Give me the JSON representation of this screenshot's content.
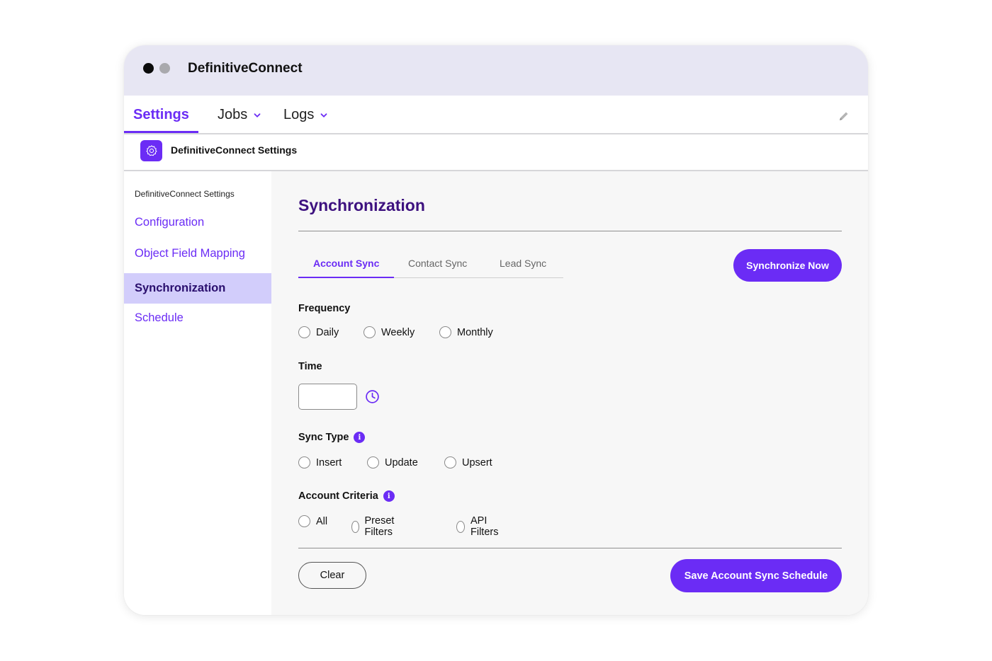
{
  "app": {
    "title": "DefinitiveConnect"
  },
  "nav": {
    "items": [
      {
        "label": "Settings"
      },
      {
        "label": "Jobs"
      },
      {
        "label": "Logs"
      }
    ]
  },
  "page_header": {
    "title": "DefinitiveConnect Settings"
  },
  "sidebar": {
    "heading": "DefinitiveConnect Settings",
    "items": [
      {
        "label": "Configuration"
      },
      {
        "label": "Object Field Mapping"
      },
      {
        "label": "Synchronization"
      },
      {
        "label": "Schedule"
      }
    ]
  },
  "main": {
    "title": "Synchronization",
    "tabs": [
      {
        "label": "Account Sync"
      },
      {
        "label": "Contact Sync"
      },
      {
        "label": "Lead Sync"
      }
    ],
    "sync_now_label": "Synchronize Now",
    "frequency": {
      "label": "Frequency",
      "options": [
        "Daily",
        "Weekly",
        "Monthly"
      ]
    },
    "time": {
      "label": "Time",
      "value": ""
    },
    "sync_type": {
      "label": "Sync Type",
      "info": "i",
      "options": [
        "Insert",
        "Update",
        "Upsert"
      ]
    },
    "account_criteria": {
      "label": "Account Criteria",
      "info": "i",
      "options": [
        "All",
        "Preset Filters",
        "API Filters"
      ]
    },
    "clear_label": "Clear",
    "save_label": "Save Account Sync Schedule"
  },
  "colors": {
    "accent": "#6b2cf5",
    "title_dark": "#3d117f",
    "titlebar": "#e7e6f3",
    "sidebar_active": "#d2cdfb"
  }
}
